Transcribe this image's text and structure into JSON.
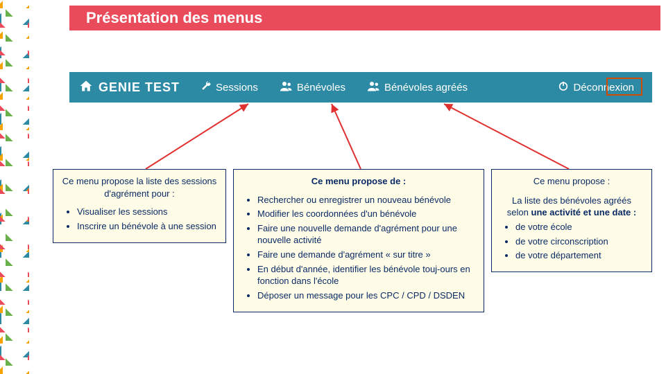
{
  "title": "Présentation des menus",
  "navbar": {
    "brand": "GENIE TEST",
    "items": [
      {
        "icon": "wrench-icon",
        "label": "Sessions"
      },
      {
        "icon": "users-icon",
        "label": "Bénévoles"
      },
      {
        "icon": "users-icon",
        "label": "Bénévoles agréés"
      },
      {
        "icon": "power-icon",
        "label": "Déconnexion"
      }
    ]
  },
  "box1": {
    "header": "Ce menu propose la liste des sessions d'agrément pour :",
    "items": [
      "Visualiser les sessions",
      "Inscrire un bénévole à une session"
    ]
  },
  "box2": {
    "header": "Ce menu propose de :",
    "items": [
      "Rechercher ou enregistrer un nouveau bénévole",
      "Modifier les coordonnées d'un bénévole",
      "Faire une nouvelle demande d'agrément pour une nouvelle activité",
      "Faire une demande d'agrément « sur titre »",
      "En début d'année, identifier les bénévole touj-ours en fonction dans l'école",
      "Déposer un message pour les CPC / CPD / DSDEN"
    ]
  },
  "box3": {
    "header": "Ce menu propose :",
    "subheader_plain": "La liste des bénévoles agréés selon ",
    "subheader_bold": "une activité et une date :",
    "items": [
      "de votre école",
      "de votre circonscription",
      "de votre département"
    ]
  }
}
